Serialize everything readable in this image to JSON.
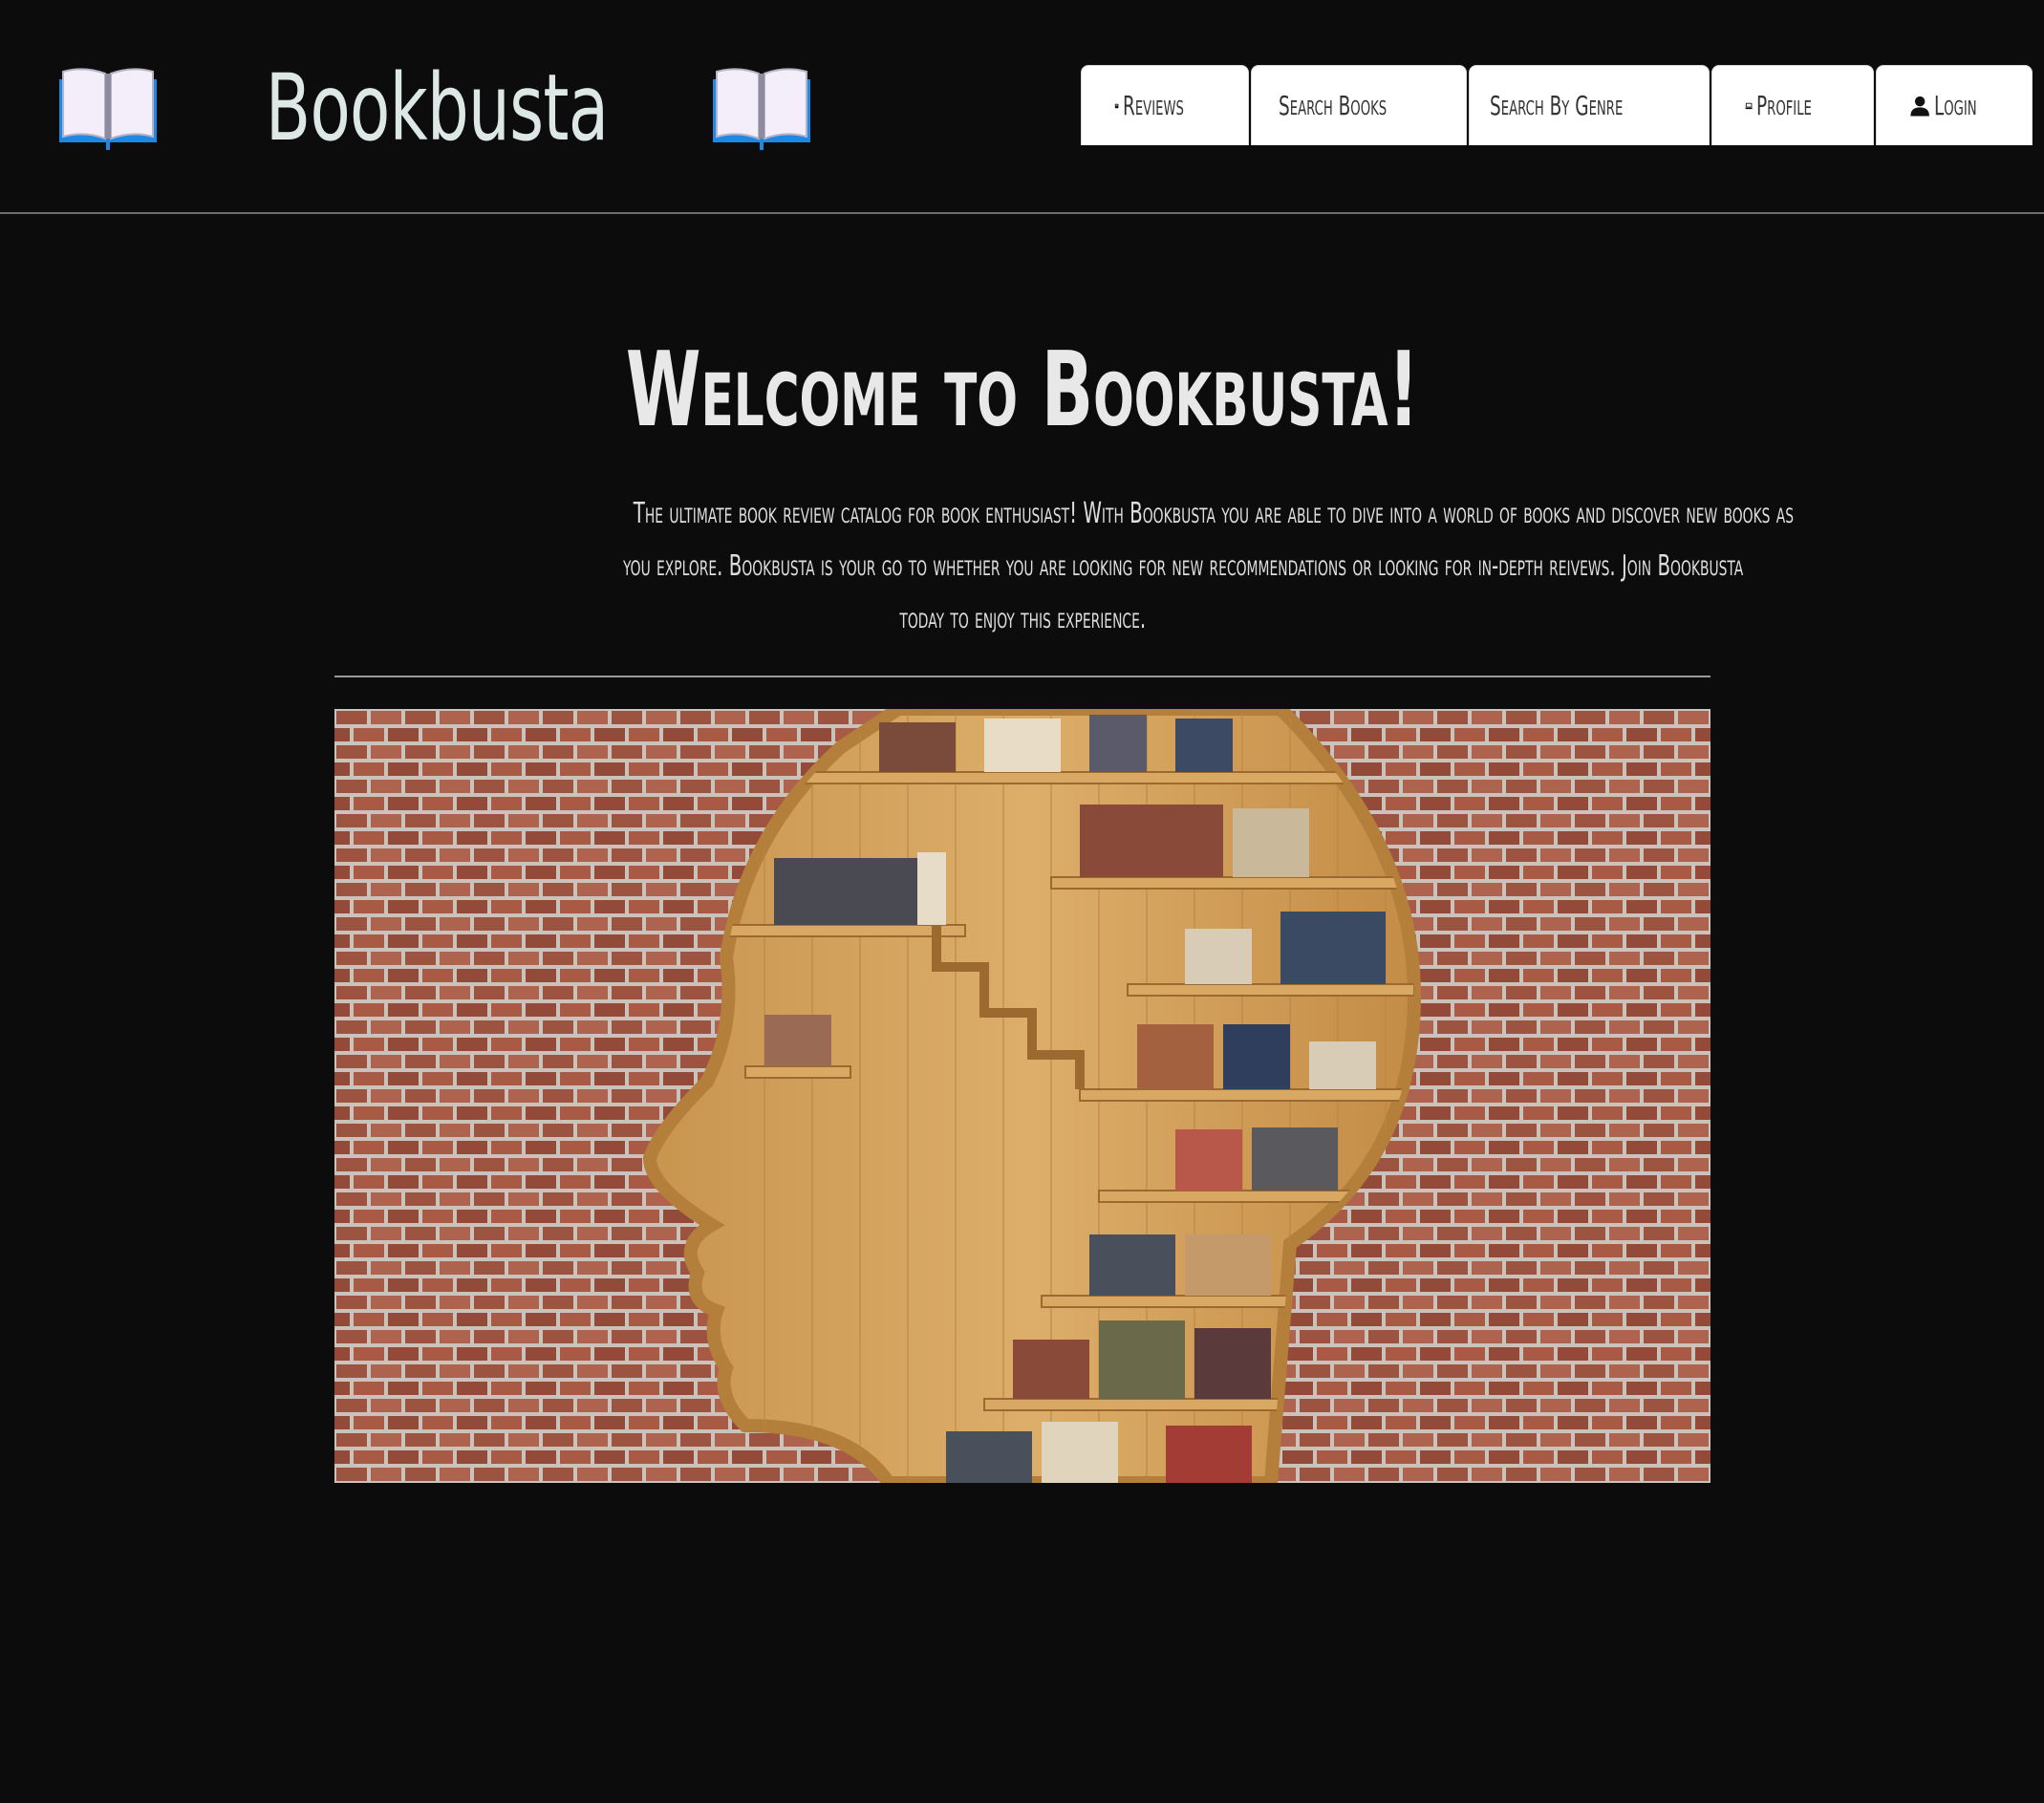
{
  "app": {
    "brand": "Bookbusta",
    "brand_icon": "open-book-icon"
  },
  "nav": {
    "items": [
      {
        "label": "Reviews",
        "icon": "book-icon"
      },
      {
        "label": "Search Books",
        "icon": "book-icon"
      },
      {
        "label": "Search By Genre",
        "icon": "search-icon"
      },
      {
        "label": "Profile",
        "icon": "laptop-icon"
      },
      {
        "label": "Login",
        "icon": "user-icon"
      }
    ]
  },
  "main": {
    "heading": "Welcome to Bookbusta!",
    "intro_lines": [
      "The ultimate book review catalog for book enthusiast! With Bookbusta you are able to dive into a world of books and discover new books as",
      "you explore. Bookbusta is your go to whether you are looking for new recommendations or looking for in-depth reivews. Join Bookbusta",
      "today to enjoy this experience."
    ],
    "hero_image": "head-shaped-bookshelf-on-brick-wall"
  },
  "colors": {
    "background": "#0c0c0d",
    "text": "#e6e6e6",
    "nav_bg": "#ffffff",
    "book_icon_blue": "#1e88e5"
  }
}
